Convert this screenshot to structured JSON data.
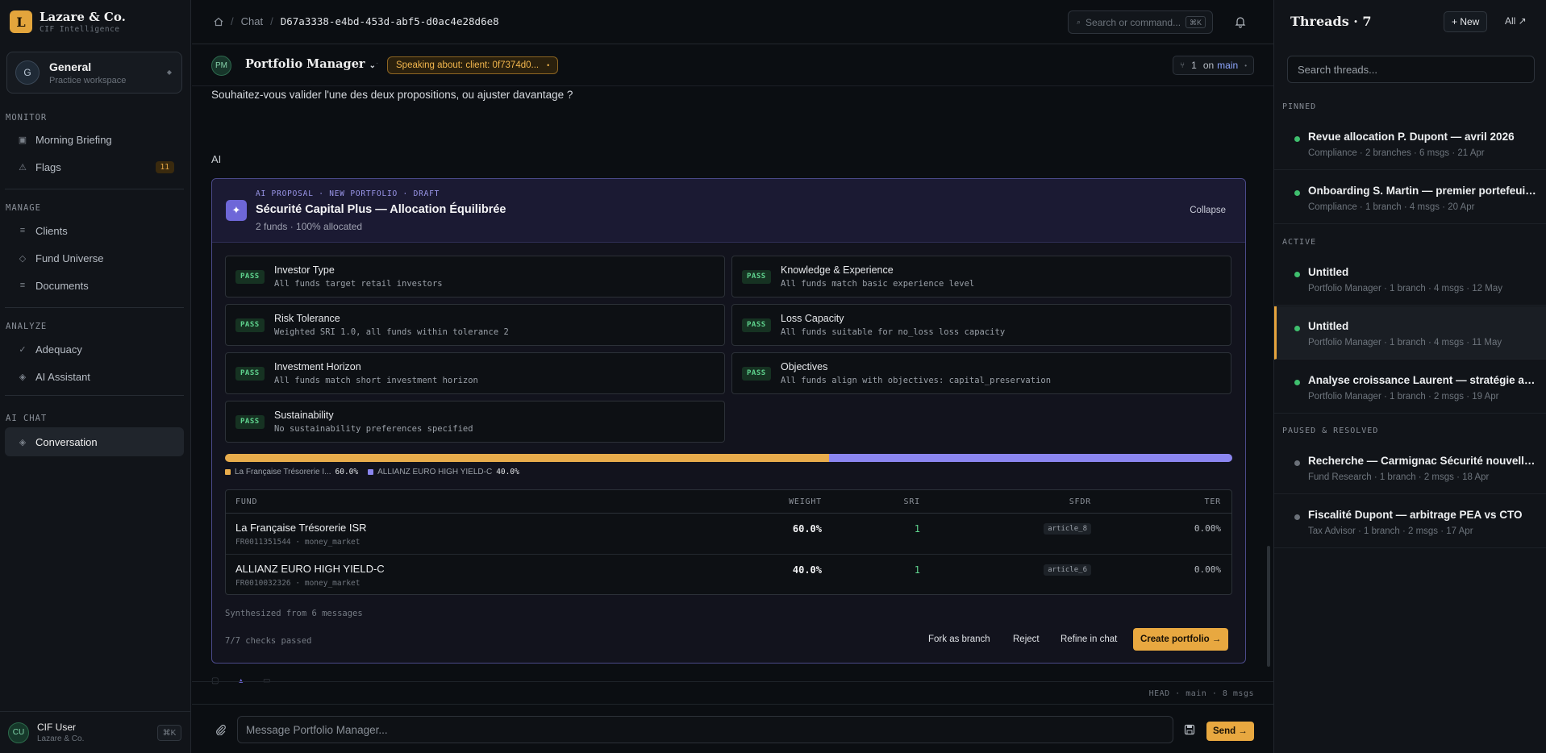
{
  "brand": {
    "logo_letter": "L",
    "name": "Lazare & Co.",
    "subtitle": "CIF Intelligence"
  },
  "workspace": {
    "avatar": "G",
    "name": "General",
    "subtitle": "Practice workspace"
  },
  "nav": {
    "monitor_label": "MONITOR",
    "morning_briefing": "Morning Briefing",
    "flags": "Flags",
    "flags_count": "11",
    "manage_label": "MANAGE",
    "clients": "Clients",
    "fund_universe": "Fund Universe",
    "documents": "Documents",
    "analyze_label": "ANALYZE",
    "adequacy": "Adequacy",
    "ai_assistant": "AI Assistant",
    "ai_chat_label": "AI CHAT",
    "conversation": "Conversation"
  },
  "user": {
    "initials": "CU",
    "name": "CIF User",
    "org": "Lazare & Co.",
    "shortcut": "⌘K"
  },
  "topbar": {
    "breadcrumb_chat": "Chat",
    "breadcrumb_id": "D67a3338-e4bd-453d-abf5-d0ac4e28d6e8",
    "search_placeholder": "Search or command...",
    "search_shortcut": "⌘K"
  },
  "agent": {
    "initials": "PM",
    "name": "Portfolio Manager",
    "speaking": "Speaking about: client: 0f7374d0...",
    "branch_count": "1",
    "branch_label": "on",
    "branch_name": "main"
  },
  "messages": {
    "user_text": "Souhaitez-vous valider l'une des deux propositions, ou ajuster davantage ?",
    "ai_label": "AI"
  },
  "proposal": {
    "kicker": "AI PROPOSAL · NEW PORTFOLIO · DRAFT",
    "title": "Sécurité Capital Plus — Allocation Équilibrée",
    "subtitle": "2 funds · 100% allocated",
    "collapse": "Collapse",
    "pass_label": "PASS",
    "checks": [
      {
        "title": "Investor Type",
        "desc": "All funds target retail investors"
      },
      {
        "title": "Knowledge & Experience",
        "desc": "All funds match basic experience level"
      },
      {
        "title": "Risk Tolerance",
        "desc": "Weighted SRI 1.0, all funds within tolerance 2"
      },
      {
        "title": "Loss Capacity",
        "desc": "All funds suitable for no_loss loss capacity"
      },
      {
        "title": "Investment Horizon",
        "desc": "All funds match short investment horizon"
      },
      {
        "title": "Objectives",
        "desc": "All funds align with objectives: capital_preservation"
      },
      {
        "title": "Sustainability",
        "desc": "No sustainability preferences specified"
      }
    ],
    "allocation": [
      {
        "label": "La Française Trésorerie I...",
        "value": "60.0%",
        "fraction": 0.6,
        "color": "#e8ac4c"
      },
      {
        "label": "ALLIANZ EURO HIGH YIELD-C",
        "value": "40.0%",
        "fraction": 0.4,
        "color": "#8b86f0"
      }
    ],
    "table_headers": {
      "fund": "FUND",
      "weight": "WEIGHT",
      "sri": "SRI",
      "sfdr": "SFDR",
      "ter": "TER"
    },
    "funds": [
      {
        "name": "La Française Trésorerie ISR",
        "isin": "FR0011351544",
        "category": "money_market",
        "weight": "60.0%",
        "sri": "1",
        "sfdr": "article_8",
        "ter": "0.00%"
      },
      {
        "name": "ALLIANZ EURO HIGH YIELD-C",
        "isin": "FR0010032326",
        "category": "money_market",
        "weight": "40.0%",
        "sri": "1",
        "sfdr": "article_6",
        "ter": "0.00%"
      }
    ],
    "meta_separator": "·",
    "synthesized": "Synthesized from 6 messages",
    "checks_passed": "7/7 checks passed",
    "fork": "Fork as branch",
    "reject": "Reject",
    "refine": "Refine in chat",
    "create": "Create portfolio →"
  },
  "status_line": "HEAD · main · 8 msgs",
  "composer": {
    "placeholder": "Message Portfolio Manager...",
    "send": "Send →"
  },
  "threads": {
    "title": "Threads · 7",
    "new": "+ New",
    "all": "All ↗",
    "search_placeholder": "Search threads...",
    "pinned_label": "PINNED",
    "active_label": "ACTIVE",
    "paused_label": "PAUSED & RESOLVED",
    "pinned": [
      {
        "title": "Revue allocation P. Dupont — avril 2026",
        "meta": "Compliance · 2 branches · 6 msgs · 21 Apr"
      },
      {
        "title": "Onboarding S. Martin — premier portefeuille",
        "meta": "Compliance · 1 branch · 4 msgs · 20 Apr"
      }
    ],
    "active": [
      {
        "title": "Untitled",
        "meta": "Portfolio Manager · 1 branch · 4 msgs · 12 May"
      },
      {
        "title": "Untitled",
        "meta": "Portfolio Manager · 1 branch · 4 msgs · 11 May"
      },
      {
        "title": "Analyse croissance Laurent — stratégie actions",
        "meta": "Portfolio Manager · 1 branch · 2 msgs · 19 Apr"
      }
    ],
    "paused": [
      {
        "title": "Recherche — Carmignac Sécurité nouvelle part",
        "meta": "Fund Research · 1 branch · 2 msgs · 18 Apr"
      },
      {
        "title": "Fiscalité Dupont — arbitrage PEA vs CTO",
        "meta": "Tax Advisor · 1 branch · 2 msgs · 17 Apr"
      }
    ]
  },
  "colors": {
    "accent": "#e8a840",
    "proposal": "#8b86f0",
    "pass": "#5fd38e",
    "active_dot": "#3fbf6e",
    "paused_dot": "#6b7179"
  }
}
